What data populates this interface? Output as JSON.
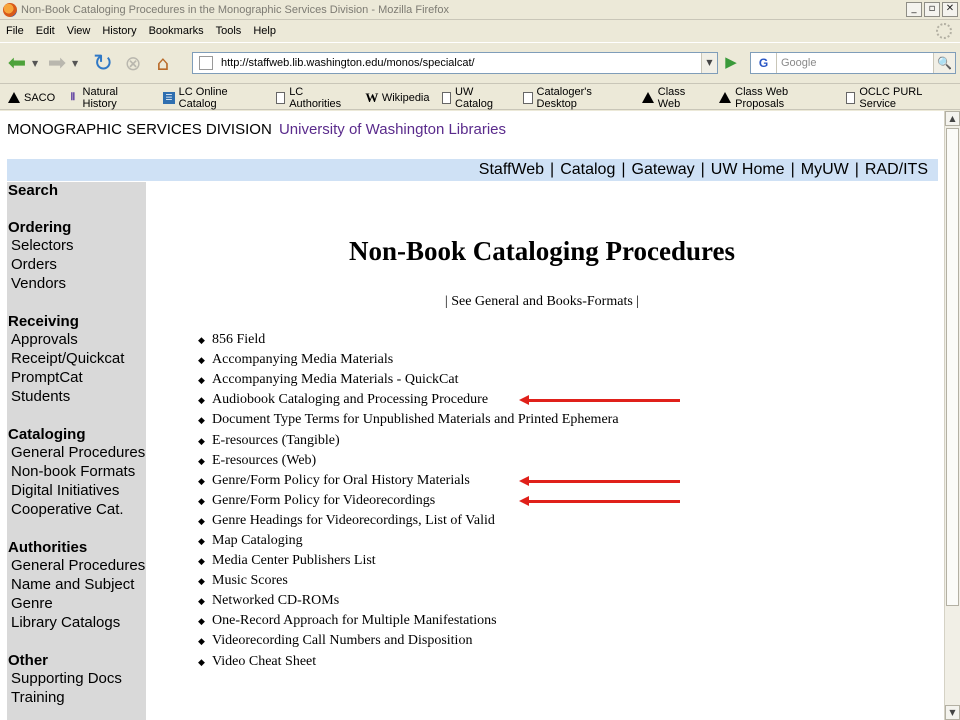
{
  "window": {
    "title": "Non-Book Cataloging Procedures in the Monographic Services Division - Mozilla Firefox",
    "controls": [
      "_",
      "▫",
      "✕"
    ]
  },
  "menu": [
    "File",
    "Edit",
    "View",
    "History",
    "Bookmarks",
    "Tools",
    "Help"
  ],
  "toolbar": {
    "url": "http://staffweb.lib.washington.edu/monos/specialcat/",
    "search_placeholder": "Google",
    "search_engine": "G"
  },
  "bookmarks": [
    {
      "label": "SACO",
      "icon": "triangle-icon"
    },
    {
      "label": "Natural History",
      "icon": "column-icon"
    },
    {
      "label": "LC Online Catalog",
      "icon": "lc-icon"
    },
    {
      "label": "LC Authorities",
      "icon": "page-icon"
    },
    {
      "label": "Wikipedia",
      "icon": "wikipedia-icon"
    },
    {
      "label": "UW Catalog",
      "icon": "page-icon"
    },
    {
      "label": "Cataloger's Desktop",
      "icon": "page-icon"
    },
    {
      "label": "Class Web",
      "icon": "triangle-icon"
    },
    {
      "label": "Class Web Proposals",
      "icon": "triangle-icon"
    },
    {
      "label": "OCLC PURL Service",
      "icon": "page-icon"
    }
  ],
  "page": {
    "division": "MONOGRAPHIC SERVICES DIVISION",
    "library": "University of Washington Libraries",
    "topnav": [
      "StaffWeb",
      "Catalog",
      "Gateway",
      "UW Home",
      "MyUW",
      "RAD/ITS"
    ],
    "sidebar": [
      {
        "heading": "Search",
        "items": []
      },
      {
        "heading": "Ordering",
        "items": [
          "Selectors",
          "Orders",
          "Vendors"
        ]
      },
      {
        "heading": "Receiving",
        "items": [
          "Approvals",
          "Receipt/Quickcat",
          "PromptCat",
          "Students"
        ]
      },
      {
        "heading": "Cataloging",
        "items": [
          "General Procedures",
          "Non-book Formats",
          "Digital Initiatives",
          "Cooperative Cat."
        ]
      },
      {
        "heading": "Authorities",
        "items": [
          "General Procedures",
          "Name and Subject",
          "Genre",
          "Library Catalogs"
        ]
      },
      {
        "heading": "Other",
        "items": [
          "Supporting Docs",
          "Training"
        ]
      }
    ],
    "title": "Non-Book Cataloging Procedures",
    "see_general": "| See General and Books-Formats |",
    "procedures": [
      "856 Field",
      "Accompanying Media Materials",
      "Accompanying Media Materials - QuickCat",
      "Audiobook Cataloging and Processing Procedure",
      "Document Type Terms for Unpublished Materials and Printed Ephemera",
      "E-resources (Tangible)",
      "E-resources (Web)",
      "Genre/Form Policy for Oral History Materials",
      "Genre/Form Policy for Videorecordings",
      "Genre Headings for Videorecordings, List of Valid",
      "Map Cataloging",
      "Media Center Publishers List",
      "Music Scores",
      "Networked CD-ROMs",
      "One-Record Approach for Multiple Manifestations",
      "Videorecording Call Numbers and Disposition",
      "Video Cheat Sheet"
    ],
    "highlighted_procedures": [
      3,
      7,
      8
    ],
    "arrow_color": "#e0201a"
  }
}
